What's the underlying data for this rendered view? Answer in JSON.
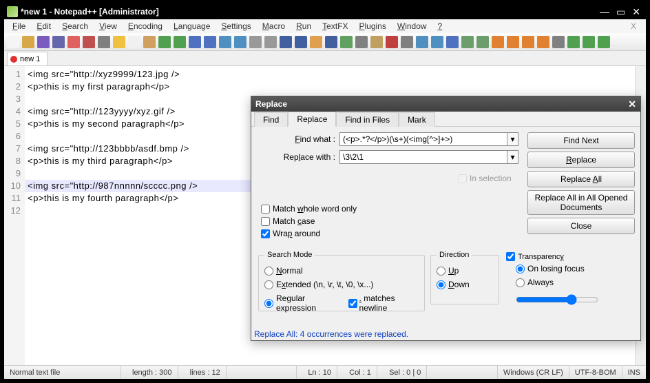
{
  "title": "*new 1 - Notepad++ [Administrator]",
  "menus": [
    "File",
    "Edit",
    "Search",
    "View",
    "Encoding",
    "Language",
    "Settings",
    "Macro",
    "Run",
    "TextFX",
    "Plugins",
    "Window",
    "?"
  ],
  "menu_hint": "X",
  "toolbar_icons": [
    "new-file-icon",
    "open-file-icon",
    "save-icon",
    "save-all-icon",
    "close-icon",
    "close-all-icon",
    "print-icon",
    "cut-icon",
    "copy-icon",
    "paste-icon",
    "undo-icon",
    "redo-icon",
    "find-icon",
    "replace-icon",
    "zoom-in-icon",
    "zoom-out-icon",
    "sync-v-icon",
    "sync-h-icon",
    "wrap-icon",
    "show-all-icon",
    "indent-guide-icon",
    "udl-icon",
    "doc-map-icon",
    "function-list-icon",
    "folder-icon",
    "macro-record-icon",
    "macro-stop-icon",
    "macro-play-icon",
    "macro-repeat-icon",
    "macro-save-icon",
    "compare-icon",
    "compare-clear-icon",
    "first-diff-icon",
    "prev-diff-icon",
    "next-diff-icon",
    "last-diff-icon",
    "nav-icon",
    "spell-icon",
    "spell-prev-icon",
    "spell-next-icon"
  ],
  "toolbar_colors": [
    "#f5f5f5",
    "#d6a84a",
    "#7a5cc1",
    "#6666aa",
    "#e06060",
    "#c05050",
    "#808080",
    "#f0c040",
    "#f0f0f0",
    "#d0a060",
    "#50a050",
    "#50a050",
    "#5070c0",
    "#5070c0",
    "#5090c0",
    "#5090c0",
    "#999",
    "#999",
    "#4060a0",
    "#4060a0",
    "#e0a050",
    "#4060a0",
    "#60a060",
    "#808080",
    "#c0a060",
    "#c04040",
    "#808080",
    "#5090c0",
    "#5090c0",
    "#5070c0",
    "#6b9e6b",
    "#6b9e6b",
    "#e08030",
    "#e08030",
    "#e08030",
    "#e08030",
    "#808080",
    "#50a050",
    "#50a050",
    "#50a050"
  ],
  "filetab": "new 1",
  "code_lines": [
    "<img src=\"http://xyz9999/123.jpg />",
    "<p>this is my first paragraph</p>",
    "",
    "<img src=\"http://123yyyy/xyz.gif />",
    "<p>this is my second paragraph</p>",
    "",
    "<img src=\"http://123bbbb/asdf.bmp />",
    "<p>this is my third paragraph</p>",
    "",
    "<img src=\"http://987nnnnn/scccc.png />",
    "<p>this is my fourth paragraph</p>",
    ""
  ],
  "highlight_line": 10,
  "status": {
    "type": "Normal text file",
    "length": "length : 300",
    "lines": "lines : 12",
    "ln": "Ln : 10",
    "col": "Col : 1",
    "sel": "Sel : 0 | 0",
    "eol": "Windows (CR LF)",
    "enc": "UTF-8-BOM",
    "mode": "INS"
  },
  "dialog": {
    "title": "Replace",
    "tabs": {
      "find": "Find",
      "replace": "Replace",
      "fif": "Find in Files",
      "mark": "Mark"
    },
    "find_label": "Find what :",
    "find_value": "(<p>.*?</p>)(\\s+)(<img[^>]+>)",
    "replace_label": "Replace with :",
    "replace_value": "\\3\\2\\1",
    "in_selection": "In selection",
    "whole_word": "Match whole word only",
    "match_case": "Match case",
    "wrap": "Wrap around",
    "search_mode_title": "Search Mode",
    "sm_normal": "Normal",
    "sm_extended": "Extended (\\n, \\r, \\t, \\0, \\x...)",
    "sm_regex": "Regular expression",
    "matches_newline": ". matches newline",
    "direction_title": "Direction",
    "dir_up": "Up",
    "dir_down": "Down",
    "transparency": "Transparency",
    "on_losing": "On losing focus",
    "always": "Always",
    "buttons": {
      "find_next": "Find Next",
      "replace": "Replace",
      "replace_all": "Replace All",
      "replace_all_open": "Replace All in All Opened Documents",
      "close": "Close"
    },
    "status_msg": "Replace All: 4 occurrences were replaced."
  }
}
